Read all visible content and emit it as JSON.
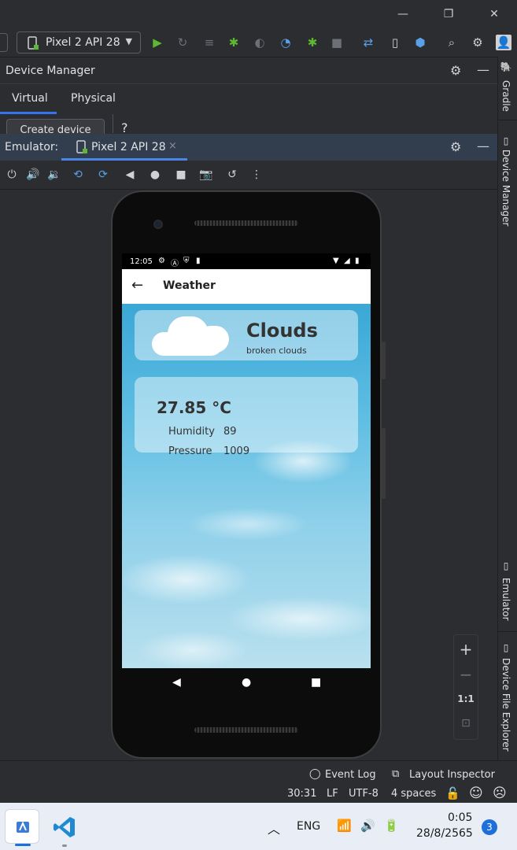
{
  "toolbar": {
    "device_selector": "Pixel 2 API 28"
  },
  "device_manager": {
    "title": "Device Manager",
    "tabs": [
      "Virtual",
      "Physical"
    ],
    "create_button": "Create device",
    "help": "?"
  },
  "emulator": {
    "label": "Emulator:",
    "tab_title": "Pixel 2 API 28",
    "tab_close": "×"
  },
  "right_tool_windows": [
    "Gradle",
    "Device Manager",
    "Emulator",
    "Device File Explorer"
  ],
  "zoom": {
    "zoom_in": "+",
    "zoom_out": "−",
    "actual_size": "1:1"
  },
  "phone": {
    "status_time": "12:05",
    "app_title": "Weather",
    "condition": "Clouds",
    "condition_desc": "broken clouds",
    "temperature": "27.85 °C",
    "humidity_label": "Humidity",
    "humidity_value": "89",
    "pressure_label": "Pressure",
    "pressure_value": "1009"
  },
  "status_bar": {
    "event_log": "Event Log",
    "layout_inspector": "Layout Inspector",
    "position": "30:31",
    "line_sep": "LF",
    "encoding": "UTF-8",
    "indent": "4 spaces"
  },
  "taskbar": {
    "language": "ENG",
    "time": "0:05",
    "date": "28/8/2565",
    "notification_count": "3"
  },
  "colors": {
    "ide_bg": "#2b2d30",
    "emulator_header_bg": "#323d4e",
    "run_green": "#5fb832",
    "accent_blue": "#3574f0"
  }
}
